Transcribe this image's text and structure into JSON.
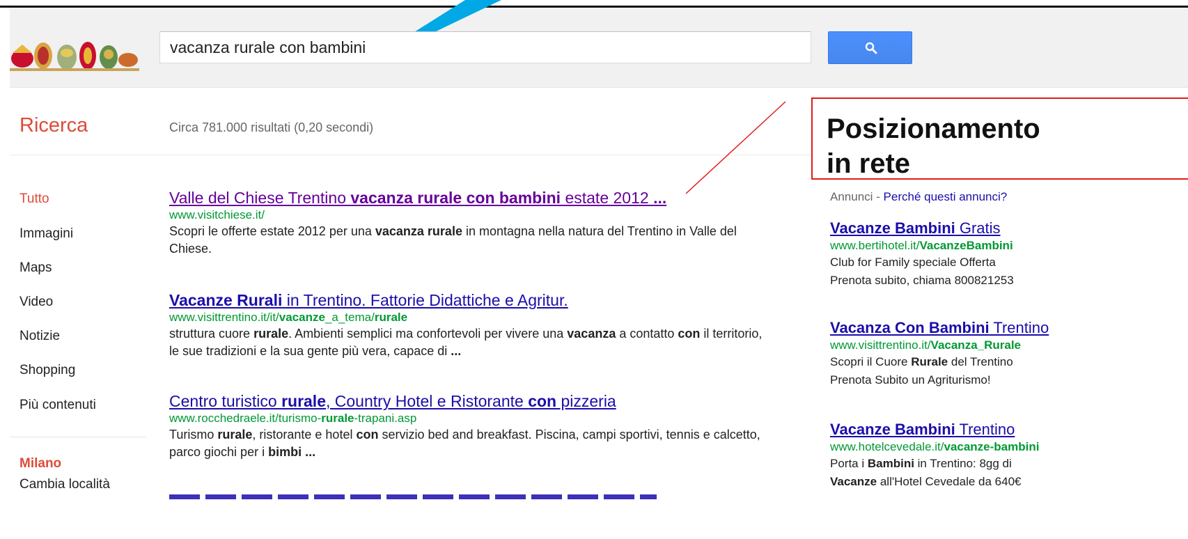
{
  "search": {
    "query": "vacanza rurale con bambini"
  },
  "header": {
    "section_label": "Ricerca",
    "stats": "Circa 781.000 risultati (0,20 secondi)"
  },
  "nav": {
    "items": [
      {
        "label": "Tutto",
        "active": true
      },
      {
        "label": "Immagini"
      },
      {
        "label": "Maps"
      },
      {
        "label": "Video"
      },
      {
        "label": "Notizie"
      },
      {
        "label": "Shopping"
      },
      {
        "label": "Più contenuti"
      }
    ],
    "location": {
      "city": "Milano",
      "change": "Cambia località"
    }
  },
  "results": [
    {
      "title_parts": [
        {
          "t": "Valle del Chiese Trentino ",
          "b": false
        },
        {
          "t": "vacanza rurale con bambini",
          "b": true
        },
        {
          "t": " estate 2012 ",
          "b": false
        },
        {
          "t": "...",
          "b": true
        }
      ],
      "visited": true,
      "url_parts": [
        {
          "t": "www.visitchiese.it/",
          "b": false
        }
      ],
      "snippet_parts": [
        {
          "t": "Scopri le offerte estate 2012 per una ",
          "b": false
        },
        {
          "t": "vacanza rurale",
          "b": true
        },
        {
          "t": " in montagna nella natura del Trentino in Valle del Chiese.",
          "b": false
        }
      ]
    },
    {
      "title_parts": [
        {
          "t": "Vacanze Rurali",
          "b": true
        },
        {
          "t": " in Trentino. Fattorie Didattiche e Agritur.",
          "b": false
        }
      ],
      "visited": false,
      "url_parts": [
        {
          "t": "www.visittrentino.it/it/",
          "b": false
        },
        {
          "t": "vacanze",
          "b": true
        },
        {
          "t": "_a_tema/",
          "b": false
        },
        {
          "t": "rurale",
          "b": true
        }
      ],
      "snippet_parts": [
        {
          "t": "struttura cuore ",
          "b": false
        },
        {
          "t": "rurale",
          "b": true
        },
        {
          "t": ". Ambienti semplici ma confortevoli per vivere una ",
          "b": false
        },
        {
          "t": "vacanza",
          "b": true
        },
        {
          "t": " a contatto ",
          "b": false
        },
        {
          "t": "con",
          "b": true
        },
        {
          "t": " il territorio, le sue tradizioni e la sua gente più vera, capace di ",
          "b": false
        },
        {
          "t": "...",
          "b": true
        }
      ]
    },
    {
      "title_parts": [
        {
          "t": "Centro turistico ",
          "b": false
        },
        {
          "t": "rurale",
          "b": true
        },
        {
          "t": ", Country Hotel e Ristorante ",
          "b": false
        },
        {
          "t": "con",
          "b": true
        },
        {
          "t": " pizzeria",
          "b": false
        }
      ],
      "visited": false,
      "url_parts": [
        {
          "t": "www.rocchedraele.it/turismo-",
          "b": false
        },
        {
          "t": "rurale",
          "b": true
        },
        {
          "t": "-trapani.asp",
          "b": false
        }
      ],
      "snippet_parts": [
        {
          "t": "Turismo ",
          "b": false
        },
        {
          "t": "rurale",
          "b": true
        },
        {
          "t": ", ristorante e hotel ",
          "b": false
        },
        {
          "t": "con",
          "b": true
        },
        {
          "t": " servizio bed and breakfast. Piscina, campi sportivi, tennis e calcetto, parco giochi per i ",
          "b": false
        },
        {
          "t": "bimbi",
          "b": true
        },
        {
          "t": " ",
          "b": false
        },
        {
          "t": "...",
          "b": true
        }
      ]
    }
  ],
  "callout": {
    "line1": "Posizionamento",
    "line2": "in rete",
    "color": "#e21b1b"
  },
  "ads": {
    "label": "Annunci - ",
    "why_link": "Perché questi annunci?",
    "items": [
      {
        "title_parts": [
          {
            "t": "Vacanze Bambini",
            "b": true
          },
          {
            "t": " Gratis",
            "b": false
          }
        ],
        "url_parts": [
          {
            "t": "www.bertihotel.it/",
            "b": false
          },
          {
            "t": "VacanzeBambini",
            "b": true
          }
        ],
        "lines": [
          [
            {
              "t": "Club for Family speciale Offerta",
              "b": false
            }
          ],
          [
            {
              "t": "Prenota subito, chiama 800821253",
              "b": false
            }
          ]
        ]
      },
      {
        "title_parts": [
          {
            "t": "Vacanza Con Bambini",
            "b": true
          },
          {
            "t": " Trentino",
            "b": false
          }
        ],
        "url_parts": [
          {
            "t": "www.visittrentino.it/",
            "b": false
          },
          {
            "t": "Vacanza_Rurale",
            "b": true
          }
        ],
        "lines": [
          [
            {
              "t": "Scopri il Cuore ",
              "b": false
            },
            {
              "t": "Rurale",
              "b": true
            },
            {
              "t": " del Trentino",
              "b": false
            }
          ],
          [
            {
              "t": "Prenota Subito un Agriturismo!",
              "b": false
            }
          ]
        ]
      },
      {
        "title_parts": [
          {
            "t": "Vacanze Bambini",
            "b": true
          },
          {
            "t": " Trentino",
            "b": false
          }
        ],
        "url_parts": [
          {
            "t": "www.hotelcevedale.it/",
            "b": false
          },
          {
            "t": "vacanze-bambini",
            "b": true
          }
        ],
        "lines": [
          [
            {
              "t": "Porta i ",
              "b": false
            },
            {
              "t": "Bambini",
              "b": true
            },
            {
              "t": " in Trentino: 8gg di",
              "b": false
            }
          ],
          [
            {
              "t": "Vacanze",
              "b": true
            },
            {
              "t": " all'Hotel Cevedale da 640€",
              "b": false
            }
          ]
        ]
      }
    ]
  },
  "colors": {
    "accent_red": "#dd4b39",
    "link_blue": "#1a0dab",
    "visited_purple": "#660099",
    "url_green": "#009933",
    "arrow_blue": "#00a8e6"
  },
  "icons": {
    "search": "magnifier-icon",
    "logo": "decorated-eggs-logo",
    "annotation": "pointer-arrow"
  }
}
